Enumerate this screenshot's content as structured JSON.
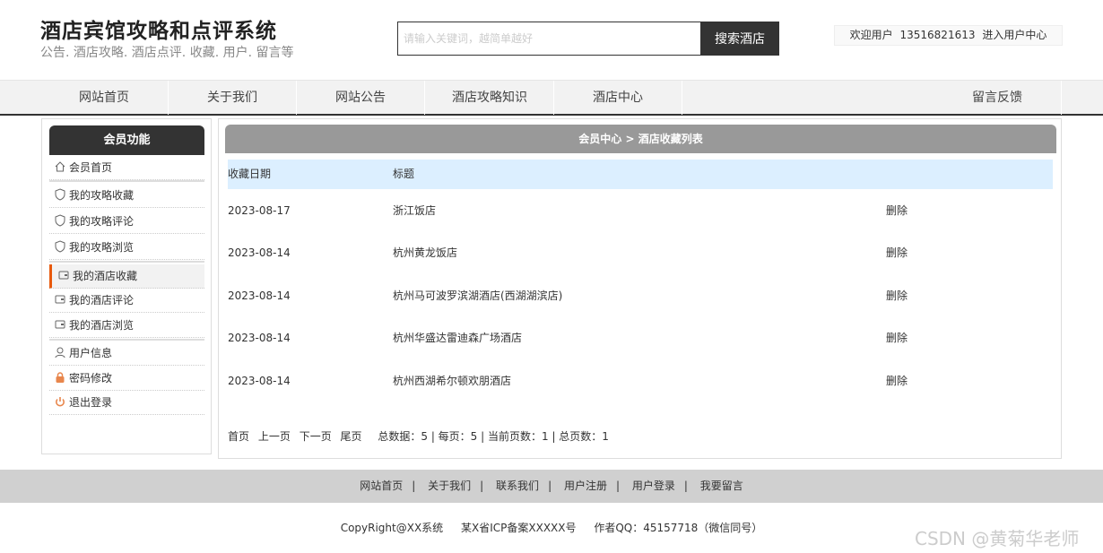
{
  "header": {
    "title": "酒店宾馆攻略和点评系统",
    "subtitle": "公告. 酒店攻略. 酒店点评. 收藏. 用户. 留言等",
    "search_placeholder": "请输入关键词，越简单越好",
    "search_button": "搜索酒店",
    "welcome_prefix": "欢迎用户",
    "phone": "13516821613",
    "user_center_link": "进入用户中心"
  },
  "nav": {
    "items": [
      "网站首页",
      "关于我们",
      "网站公告",
      "酒店攻略知识",
      "酒店中心",
      "留言反馈"
    ]
  },
  "sidebar": {
    "heading": "会员功能",
    "items": [
      {
        "label": "会员首页",
        "icon": "home-icon"
      },
      {
        "label": "我的攻略收藏",
        "icon": "shield-icon"
      },
      {
        "label": "我的攻略评论",
        "icon": "shield-icon"
      },
      {
        "label": "我的攻略浏览",
        "icon": "shield-icon"
      },
      {
        "label": "我的酒店收藏",
        "icon": "card-icon"
      },
      {
        "label": "我的酒店评论",
        "icon": "card-icon"
      },
      {
        "label": "我的酒店浏览",
        "icon": "card-icon"
      },
      {
        "label": "用户信息",
        "icon": "user-icon"
      },
      {
        "label": "密码修改",
        "icon": "lock-icon"
      },
      {
        "label": "退出登录",
        "icon": "power-icon"
      }
    ]
  },
  "main": {
    "breadcrumb": "会员中心 > 酒店收藏列表",
    "columns": [
      "收藏日期",
      "标题"
    ],
    "rows": [
      {
        "date": "2023-08-17",
        "title": "浙江饭店",
        "action": "删除"
      },
      {
        "date": "2023-08-14",
        "title": "杭州黄龙饭店",
        "action": "删除"
      },
      {
        "date": "2023-08-14",
        "title": "杭州马可波罗滨湖酒店(西湖湖滨店)",
        "action": "删除"
      },
      {
        "date": "2023-08-14",
        "title": "杭州华盛达雷迪森广场酒店",
        "action": "删除"
      },
      {
        "date": "2023-08-14",
        "title": "杭州西湖希尔顿欢朋酒店",
        "action": "删除"
      }
    ],
    "pager": {
      "first": "首页",
      "prev": "上一页",
      "next": "下一页",
      "last": "尾页",
      "info": "总数据：5 | 每页：5 | 当前页数：1 | 总页数：1"
    }
  },
  "footer": {
    "links": [
      "网站首页",
      "关于我们",
      "联系我们",
      "用户注册",
      "用户登录",
      "我要留言"
    ],
    "separator": "|",
    "copyright": "CopyRight@XX系统",
    "icp": "某X省ICP备案XXXXX号",
    "qq": "作者QQ：45157718（微信同号）",
    "watermark": "CSDN @黄菊华老师"
  },
  "colors": {
    "accent": "#e8590c",
    "dark": "#333333",
    "table_header": "#dcefff"
  }
}
